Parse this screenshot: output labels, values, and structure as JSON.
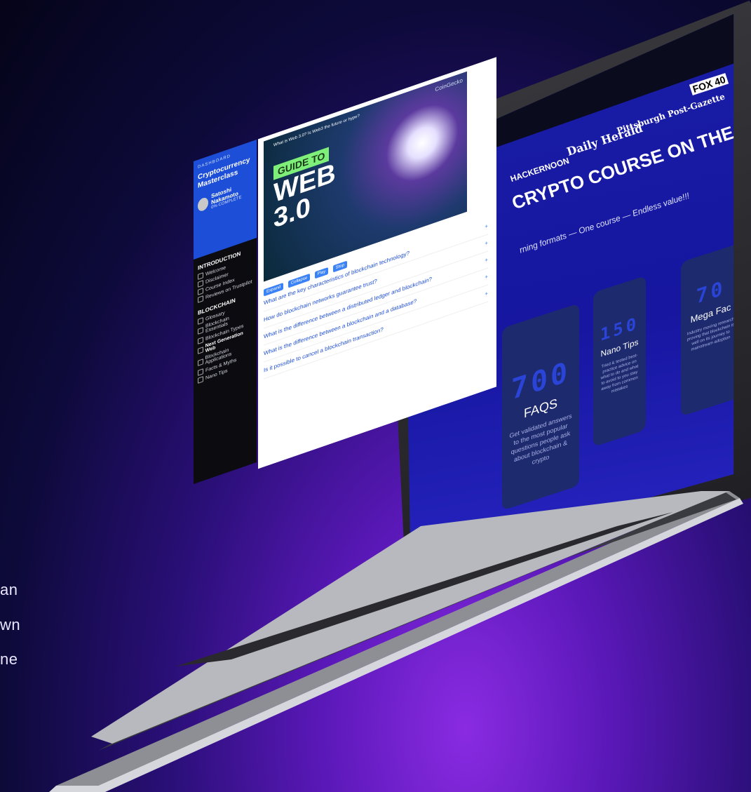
{
  "background": {
    "lines": [
      "an",
      "wn",
      "ne"
    ]
  },
  "laptop": {
    "brands": [
      "HACKERNOON",
      "Daily Herald",
      "Pittsburgh Post-Gazette",
      "FOX 40"
    ],
    "headline": "CRYPTO COURSE ON THE INTERNET",
    "subline": "rning formats — One course — Endless value!!!",
    "cards": [
      {
        "num": "700",
        "title": "FAQS",
        "desc": "Get validated answers to the most popular questions people ask about blockchain & crypto"
      },
      {
        "num": "150",
        "title": "Nano Tips",
        "desc": "Tried & tested best-practice advice on what to do and what to avoid to you stay away from common mistakes"
      },
      {
        "num": "70",
        "title": "Mega Fac",
        "desc": "Industry moving research proving that blockchain is well on its journey to mainstream adoption"
      }
    ]
  },
  "app": {
    "dashboard": "DASHBOARD",
    "course": "Cryptocurrency Masterclass",
    "user_name": "Satoshi Nakamoto",
    "user_plan": "0% COMPLETE",
    "sections": [
      {
        "title": "INTRODUCTION",
        "items": [
          "Welcome",
          "Disclaimer",
          "Course Index",
          "Reviews on Trustpilot"
        ]
      },
      {
        "title": "BLOCKCHAIN",
        "items": [
          "Glossary",
          "Blockchain Essentials",
          "Blockchain Types",
          "Next Generation Web",
          "Blockchain Applications",
          "Facts & Myths",
          "Nano Tips"
        ]
      }
    ],
    "video": {
      "title": "What is Web 3.0? Is Web3 the future or hype?",
      "brand": "CoinGecko",
      "guide": "GUIDE TO",
      "web": "WEB",
      "version": "3.0"
    },
    "filters": [
      "Expand",
      "Collapse",
      "Play",
      "Stop"
    ],
    "questions": [
      "What are the key characteristics of blockchain technology?",
      "How do blockchain networks guarantee trust?",
      "What is the difference between a distributed ledger and blockchain?",
      "What is the difference between a blockchain and a database?",
      "Is it possible to cancel a blockchain transaction?"
    ]
  }
}
